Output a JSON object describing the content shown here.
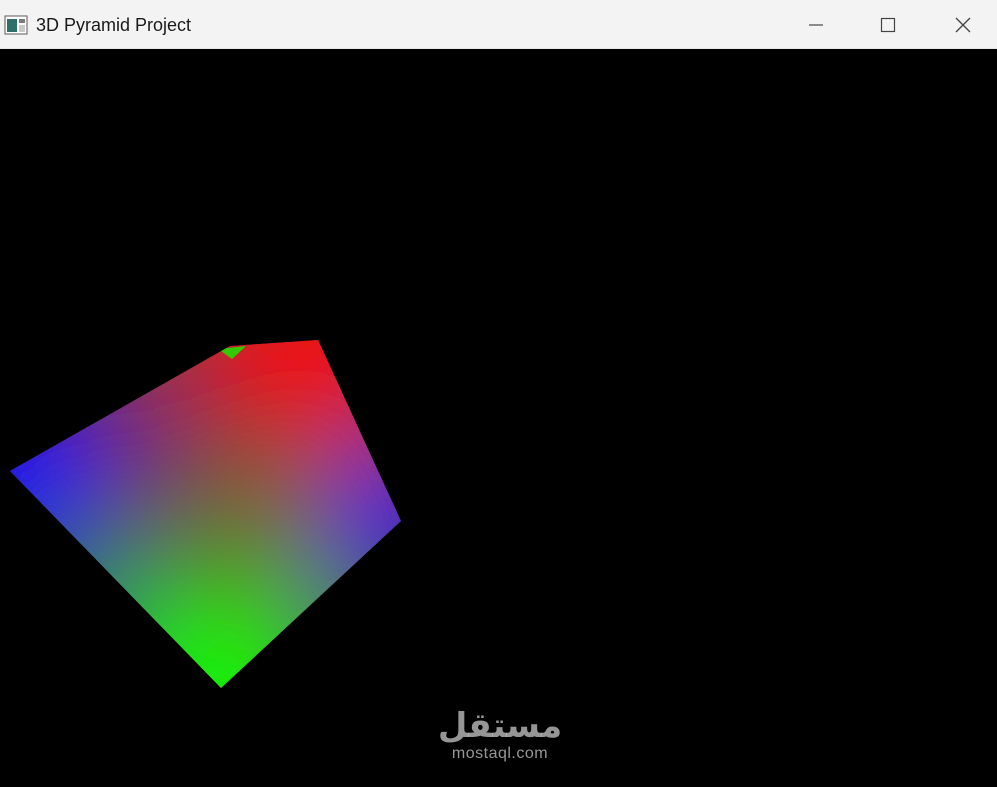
{
  "window": {
    "title": "3D Pyramid Project",
    "controls": {
      "minimize": "minimize-icon",
      "maximize": "maximize-icon",
      "close": "close-icon"
    }
  },
  "scene": {
    "background": "#000000",
    "object": "pyramid",
    "vertex_colors": [
      "#ff0000",
      "#00ff00",
      "#0000ff"
    ]
  },
  "watermark": {
    "arabic": "مستقل",
    "latin": "mostaql.com"
  }
}
